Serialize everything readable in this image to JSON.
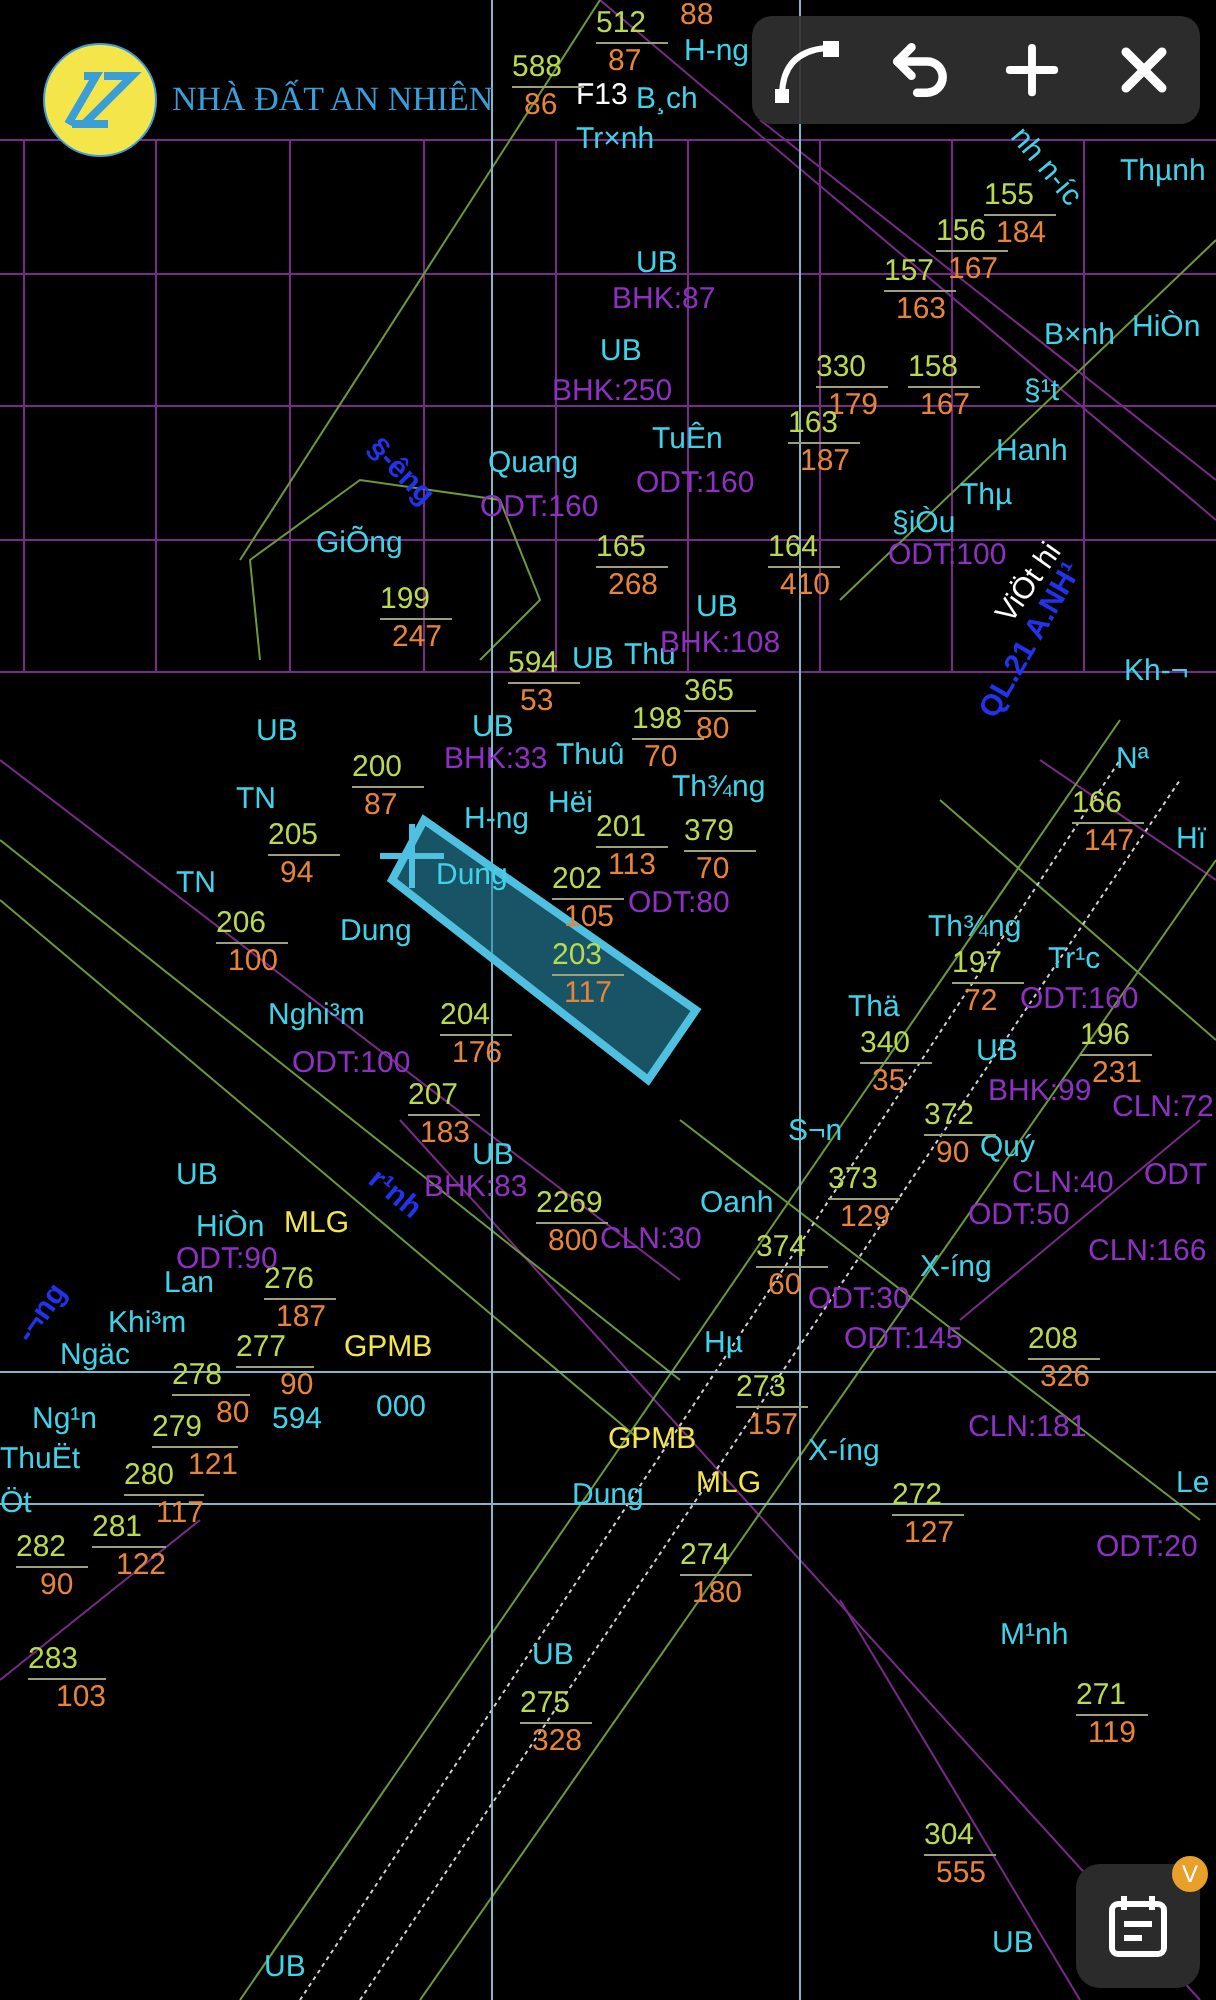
{
  "logo": {
    "text": "NHÀ ĐẤT AN NHIÊN"
  },
  "map": {
    "texts": [
      {
        "kind": "area",
        "text": "88"
      },
      {
        "kind": "plain",
        "text": "F13"
      },
      {
        "kind": "plain",
        "text": "ViÖt hi"
      }
    ],
    "names": [
      "H-ng",
      "B¸ch",
      "Tr×nh",
      "nh n-íc",
      "Thµnh",
      "UB",
      "UB",
      "B×nh",
      "HiÒn",
      "§¹t",
      "Quang",
      "TuÊn",
      "Hanh",
      "Thµ",
      "§iÒu",
      "GiÕng",
      "UB",
      "UB",
      "Thu",
      "Kh-¬",
      "UB",
      "UB",
      "Thuû",
      "Nª",
      "TN",
      "H-ng",
      "Hëi",
      "Th¾ng",
      "Hï",
      "TN",
      "Dung",
      "Dung",
      "Th¾ng",
      "Tr¹c",
      "Nghi³m",
      "Thä",
      "UB",
      "UB",
      "S¬n",
      "Quý",
      "UB",
      "Oanh",
      "HiÒn",
      "Lan",
      "X-íng",
      "Khi³m",
      "Ngäc",
      "Hµ",
      "Ng¹n",
      "594",
      "000",
      "ThuËt",
      "X-íng",
      "Öt",
      "Dung",
      "Le",
      "M¹nh",
      "UB",
      "UB",
      "UB"
    ],
    "parcels": [
      {
        "number": "512",
        "area": "87"
      },
      {
        "number": "588",
        "area": "86"
      },
      {
        "number": "155",
        "area": "184"
      },
      {
        "number": "156",
        "area": "167"
      },
      {
        "number": "157",
        "area": "163"
      },
      {
        "number": "330",
        "area": "179"
      },
      {
        "number": "158",
        "area": "167"
      },
      {
        "number": "163",
        "area": "187"
      },
      {
        "number": "165",
        "area": "268"
      },
      {
        "number": "164",
        "area": "410"
      },
      {
        "number": "199",
        "area": "247"
      },
      {
        "number": "594",
        "area": "53"
      },
      {
        "number": "198",
        "area": "70"
      },
      {
        "number": "365",
        "area": "80"
      },
      {
        "number": "200",
        "area": "87"
      },
      {
        "number": "205",
        "area": "94"
      },
      {
        "number": "201",
        "area": "113"
      },
      {
        "number": "379",
        "area": "70"
      },
      {
        "number": "166",
        "area": "147"
      },
      {
        "number": "202",
        "area": "105"
      },
      {
        "number": "206",
        "area": "100"
      },
      {
        "number": "203",
        "area": "117"
      },
      {
        "number": "197",
        "area": "72"
      },
      {
        "number": "204",
        "area": "176"
      },
      {
        "number": "340",
        "area": "35"
      },
      {
        "number": "196",
        "area": "231"
      },
      {
        "number": "207",
        "area": "183"
      },
      {
        "number": "372",
        "area": "90"
      },
      {
        "number": "2269",
        "area": "800"
      },
      {
        "number": "373",
        "area": "129"
      },
      {
        "number": "276",
        "area": "187"
      },
      {
        "number": "374",
        "area": "60"
      },
      {
        "number": "278",
        "area": "80"
      },
      {
        "number": "277",
        "area": "90"
      },
      {
        "number": "208",
        "area": "326"
      },
      {
        "number": "273",
        "area": "157"
      },
      {
        "number": "279",
        "area": "121"
      },
      {
        "number": "280",
        "area": "117"
      },
      {
        "number": "282",
        "area": "90"
      },
      {
        "number": "281",
        "area": "122"
      },
      {
        "number": "272",
        "area": "127"
      },
      {
        "number": "274",
        "area": "180"
      },
      {
        "number": "283",
        "area": "103"
      },
      {
        "number": "275",
        "area": "328"
      },
      {
        "number": "271",
        "area": "119"
      },
      {
        "number": "304",
        "area": "555"
      }
    ],
    "land_use": [
      "BHK:87",
      "BHK:250",
      "ODT:160",
      "ODT:160",
      "ODT:100",
      "BHK:108",
      "BHK:33",
      "ODT:80",
      "ODT:160",
      "ODT:100",
      "BHK:99",
      "CLN:72",
      "BHK:83",
      "CLN:40",
      "ODT",
      "ODT:50",
      "CLN:30",
      "ODT:90",
      "CLN:166",
      "ODT:30",
      "ODT:145",
      "CLN:181",
      "ODT:20"
    ],
    "roads": [
      "§-êng",
      "QL.21 A.NH¹",
      "r¹nh",
      "-¬ng"
    ],
    "notes": [
      "MLG",
      "GPMB",
      "GPMB",
      "MLG"
    ]
  },
  "notes_button": {
    "badge": "V"
  }
}
